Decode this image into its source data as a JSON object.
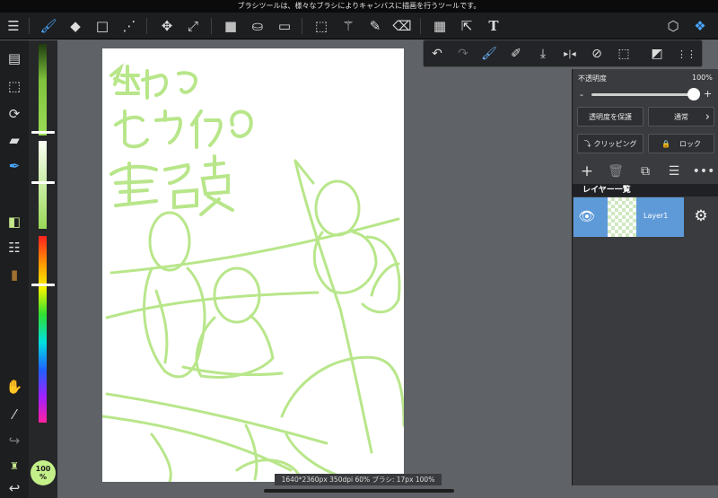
{
  "statusbar": {
    "hint": "ブラシツールは、様々なブラシによりキャンバスに描画を行うツールです。"
  },
  "toolbar": {
    "items": [
      {
        "name": "menu-icon",
        "glyph": "☰"
      },
      {
        "name": "brush-tool-icon",
        "glyph": "🖌"
      },
      {
        "name": "eraser-tool-icon",
        "glyph": "◆"
      },
      {
        "name": "object-tool-icon",
        "glyph": "□"
      },
      {
        "name": "dot-tool-icon",
        "glyph": "⋰"
      },
      {
        "name": "move-tool-icon",
        "glyph": "✥"
      },
      {
        "name": "transform-tool-icon",
        "glyph": "⤢"
      },
      {
        "name": "fill-color-icon",
        "glyph": "■"
      },
      {
        "name": "bucket-tool-icon",
        "glyph": "⛀"
      },
      {
        "name": "gradient-tool-icon",
        "glyph": "▭"
      },
      {
        "name": "select-tool-icon",
        "glyph": "⬚"
      },
      {
        "name": "magic-wand-icon",
        "glyph": "⚚"
      },
      {
        "name": "select-pen-icon",
        "glyph": "✎"
      },
      {
        "name": "select-eraser-icon",
        "glyph": "⌫"
      },
      {
        "name": "frame-divider-icon",
        "glyph": "▦"
      },
      {
        "name": "operation-tool-icon",
        "glyph": "⇱"
      },
      {
        "name": "text-tool-icon",
        "glyph": "T"
      },
      {
        "name": "material-icon",
        "glyph": "⬡"
      },
      {
        "name": "layers-icon",
        "glyph": "❖"
      }
    ]
  },
  "left_tools": [
    {
      "name": "pages-icon",
      "glyph": "▤"
    },
    {
      "name": "selection-list-icon",
      "glyph": "⬚"
    },
    {
      "name": "rotate-icon",
      "glyph": "⟳"
    },
    {
      "name": "ruler-icon",
      "glyph": "📏"
    },
    {
      "name": "brush-palette-icon",
      "glyph": "✒"
    },
    {
      "name": "color-swap-icon",
      "glyph": "◧"
    },
    {
      "name": "brush-list-icon",
      "glyph": "☷"
    },
    {
      "name": "color-history-icon",
      "glyph": "▮"
    },
    {
      "name": "hand-tool-icon",
      "glyph": "✋"
    },
    {
      "name": "eyedropper-icon",
      "glyph": "⁄"
    },
    {
      "name": "redo-icon",
      "glyph": "↪"
    },
    {
      "name": "lock-alpha-icon",
      "glyph": "♜"
    },
    {
      "name": "undo-icon",
      "glyph": "↩"
    }
  ],
  "zoom": {
    "line1": "100",
    "line2": "%"
  },
  "popup_tools": [
    {
      "name": "undo-icon",
      "glyph": "↶"
    },
    {
      "name": "redo-icon",
      "glyph": "↷"
    },
    {
      "name": "brush-stabilizer-icon",
      "glyph": "🖌"
    },
    {
      "name": "eyedropper-icon",
      "glyph": "✐"
    },
    {
      "name": "save-icon",
      "glyph": "⤓"
    },
    {
      "name": "flip-horizontal-icon",
      "glyph": "▸|◂"
    },
    {
      "name": "snap-off-icon",
      "glyph": "⊘"
    },
    {
      "name": "clear-icon",
      "glyph": "⬚"
    },
    {
      "name": "filter-icon",
      "glyph": "◩"
    },
    {
      "name": "grid-icon",
      "glyph": "⋮⋮"
    }
  ],
  "layer_panel": {
    "opacity_label": "不透明度",
    "opacity_value": "100%",
    "minus": "-",
    "plus": "+",
    "protect_alpha": "透明度を保護",
    "blend_mode": "通常",
    "blend_arrow": "›",
    "clipping": "クリッピング",
    "lock": "ロック",
    "list_title": "レイヤー一覧",
    "layers": [
      {
        "name": "Layer1"
      }
    ]
  },
  "canvas_info": "1640*2360px 350dpi 60% ブラシ: 17px 100%",
  "canvas_title": [
    "終わる",
    "セカイの",
    "舞台裏"
  ],
  "colors": {
    "sketch": "#b8e68a",
    "accent": "#4aa7ff",
    "layer_selected": "#5f9ad8"
  }
}
